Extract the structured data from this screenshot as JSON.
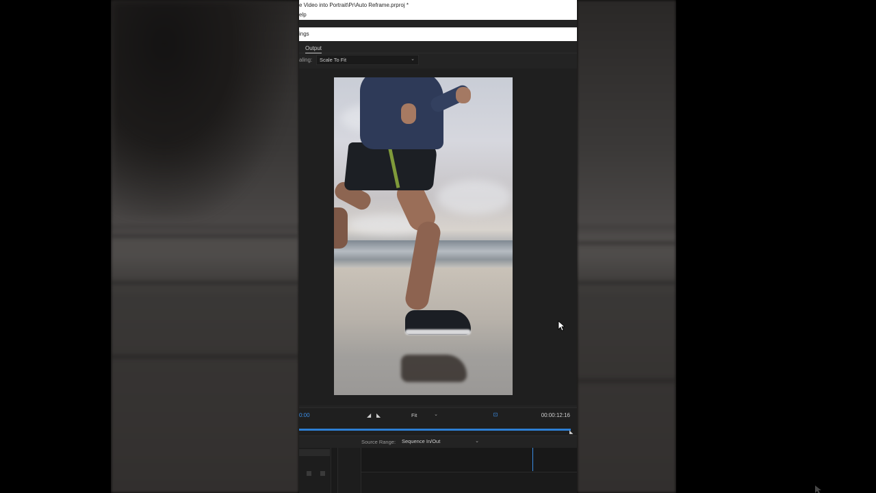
{
  "window": {
    "title": "e Video into Portrait\\Pr\\Auto Reframe.prproj *",
    "menu": "elp"
  },
  "dialog": {
    "title": "ings"
  },
  "tabs": {
    "output_label": "Output"
  },
  "scaling": {
    "label": "aling:",
    "value": "Scale To Fit"
  },
  "transport": {
    "timecode_in": "0:00",
    "fit_value": "Fit",
    "timecode_out": "00:00:12:16"
  },
  "source_range": {
    "label": "Source Range:",
    "value": "Sequence In/Out"
  },
  "colors": {
    "accent": "#2d7fd4",
    "timecode_blue": "#3b8de6",
    "panel_bg": "#232323",
    "title_bg": "#ffffff"
  },
  "icons": {
    "mark_in": "mark-in-icon",
    "mark_out": "mark-out-icon",
    "safe_margins": "safe-margins-icon",
    "dropdown": "chevron-down-icon",
    "cursor": "mouse-cursor-icon"
  }
}
